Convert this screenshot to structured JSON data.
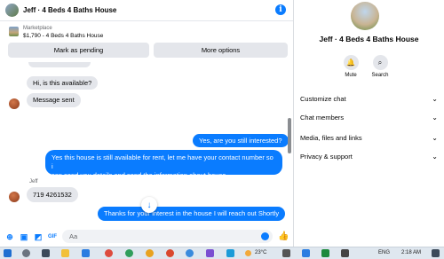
{
  "header": {
    "title": "Jeff · 4 Beds 4 Baths House"
  },
  "marketplace": {
    "label": "Marketplace",
    "listing": "$1,790 - 4 Beds 4 Baths House",
    "pending_button": "Mark as pending",
    "more_button": "More options"
  },
  "messages": [
    {
      "text": "Hi, is this available?",
      "direction": "in"
    },
    {
      "text": "Message sent",
      "direction": "in"
    },
    {
      "text": "Yes, are you still interested?",
      "direction": "out"
    },
    {
      "text": "Yes this house is still available for rent, let me have your contact number so i",
      "text2": "can send you details and send the information about house.",
      "direction": "out"
    },
    {
      "sender": "Jeff",
      "text": "719 4261532",
      "direction": "in"
    },
    {
      "text": "Thanks for your interest in the house I will reach out Shortly",
      "direction": "out"
    }
  ],
  "composer": {
    "placeholder": "Aa"
  },
  "info": {
    "title": "Jeff · 4 Beds 4 Baths House",
    "mute": "Mute",
    "search": "Search",
    "sections": [
      "Customize chat",
      "Chat members",
      "Media, files and links",
      "Privacy & support"
    ]
  },
  "taskbar": {
    "temperature": "23°C",
    "language": "ENG",
    "time": "2:18 AM"
  },
  "colors": {
    "accent": "#0a7cff",
    "incoming": "#e4e6eb"
  }
}
